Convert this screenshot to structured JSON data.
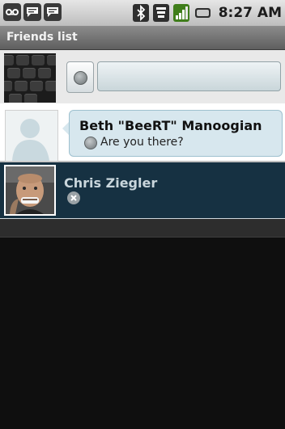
{
  "status_bar": {
    "notifications": [
      "voicemail-icon",
      "chat-icon",
      "chat-icon"
    ],
    "indicators": [
      "bluetooth-icon",
      "wifi-icon",
      "signal-icon",
      "battery-icon"
    ],
    "time": "8:27 AM"
  },
  "title_bar": {
    "title": "Friends list"
  },
  "self_row": {
    "avatar_icon": "keyboard-photo",
    "presence_icon": "status-dot-icon",
    "status_message": ""
  },
  "friends": [
    {
      "name": "Beth \"BeeRT\" Manoogian",
      "status_message": "Are you there?",
      "presence": "idle",
      "avatar_icon": "default-avatar",
      "has_unread": true
    },
    {
      "name": "Chris Ziegler",
      "status_message": "",
      "presence": "offline",
      "avatar_icon": "photo-avatar",
      "has_unread": false
    }
  ],
  "colors": {
    "title_bar": "#6f6f6f",
    "selected_row": "#163142",
    "bubble": "#d7e7ee"
  }
}
